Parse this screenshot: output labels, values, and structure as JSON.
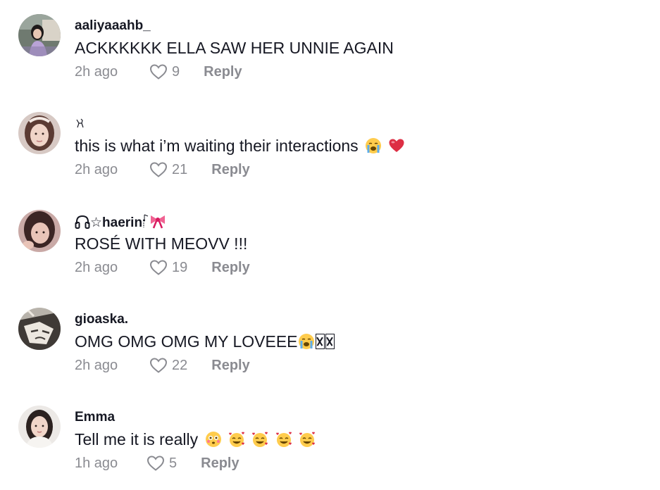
{
  "comments": [
    {
      "username": "aaliyaaahb_",
      "text": "ACKKKKKK ELLA SAW HER UNNIE AGAIN",
      "time": "2h ago",
      "likes": "9",
      "reply": "Reply"
    },
    {
      "username": "",
      "text": "this is what i’m waiting their interactions",
      "time": "2h ago",
      "likes": "21",
      "reply": "Reply"
    },
    {
      "username": "☆haerin",
      "text": "ROSÉ WITH MEOVV !!!",
      "time": "2h ago",
      "likes": "19",
      "reply": "Reply"
    },
    {
      "username": "gioaska.",
      "text": "OMG OMG OMG MY LOVEEE",
      "time": "2h ago",
      "likes": "22",
      "reply": "Reply"
    },
    {
      "username": "Emma",
      "text": "Tell me it is really",
      "time": "1h ago",
      "likes": "5",
      "reply": "Reply"
    }
  ]
}
